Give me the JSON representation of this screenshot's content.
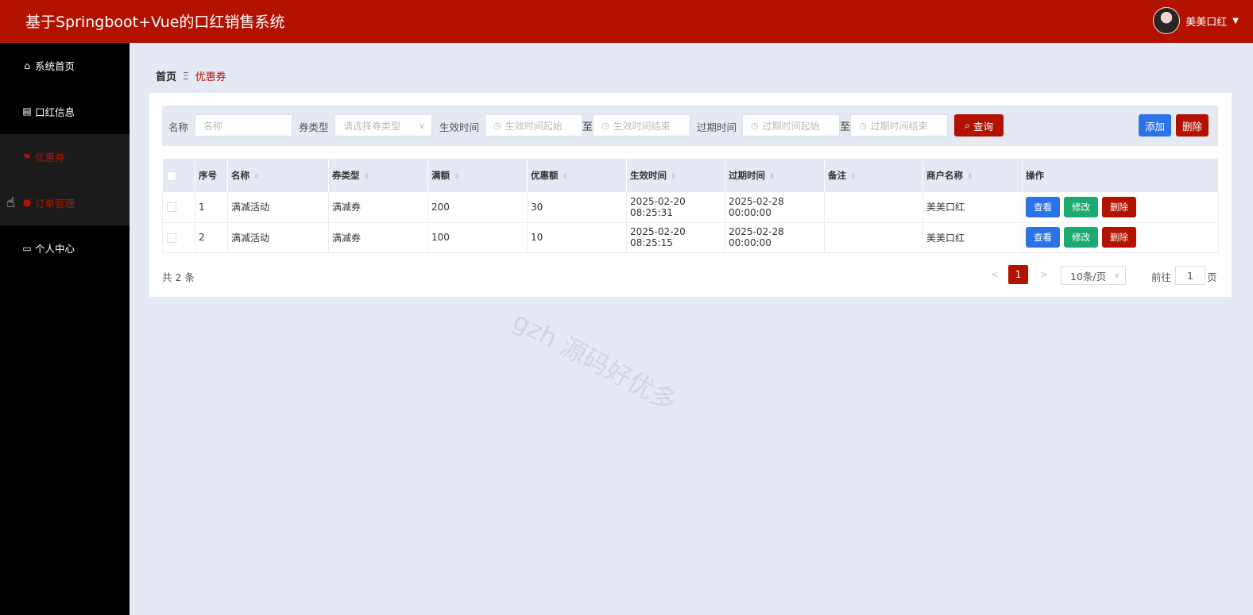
{
  "header": {
    "title": "基于Springboot+Vue的口红销售系统",
    "user_name": "美美口红"
  },
  "sidebar": {
    "items": [
      {
        "label": "系统首页",
        "icon": "home-icon"
      },
      {
        "label": "口红信息",
        "icon": "clipboard-icon"
      },
      {
        "label": "优惠券",
        "icon": "flag-icon"
      },
      {
        "label": "订单管理",
        "icon": "user-icon"
      },
      {
        "label": "个人中心",
        "icon": "card-icon"
      }
    ]
  },
  "breadcrumb": {
    "home": "首页",
    "separator": "Ξ",
    "current": "优惠券"
  },
  "search": {
    "name_label": "名称",
    "name_placeholder": "名称",
    "type_label": "券类型",
    "type_placeholder": "请选择券类型",
    "effective_label": "生效时间",
    "effective_start_placeholder": "生效时间起始",
    "to1": "至",
    "effective_end_placeholder": "生效时间结束",
    "expire_label": "过期时间",
    "expire_start_placeholder": "过期时间起始",
    "to2": "至",
    "expire_end_placeholder": "过期时间结束",
    "query_button": "查询",
    "add_button": "添加",
    "delete_button": "删除"
  },
  "table": {
    "headers": [
      "序号",
      "名称",
      "券类型",
      "满额",
      "优惠额",
      "生效时间",
      "过期时间",
      "备注",
      "商户名称",
      "操作"
    ],
    "rows": [
      {
        "index": "1",
        "name": "满减活动",
        "type": "满减券",
        "threshold": "200",
        "discount": "30",
        "effective": "2025-02-20 08:25:31",
        "expire": "2025-02-28 00:00:00",
        "note": "",
        "merchant": "美美口红"
      },
      {
        "index": "2",
        "name": "满减活动",
        "type": "满减券",
        "threshold": "100",
        "discount": "10",
        "effective": "2025-02-20 08:25:15",
        "expire": "2025-02-28 00:00:00",
        "note": "",
        "merchant": "美美口红"
      }
    ],
    "actions": {
      "view": "查看",
      "edit": "修改",
      "delete": "删除"
    }
  },
  "pagination": {
    "total": "共 2 条",
    "prev": "<",
    "current_page": "1",
    "next": ">",
    "page_size": "10条/页",
    "goto_label": "前往",
    "goto_value": "1",
    "page_label": "页"
  },
  "watermark": "gzh 源码好优多",
  "colors": {
    "brand": "#b31200",
    "primary": "#2d73e8",
    "success": "#1daa72",
    "background": "#e4e9f3"
  }
}
